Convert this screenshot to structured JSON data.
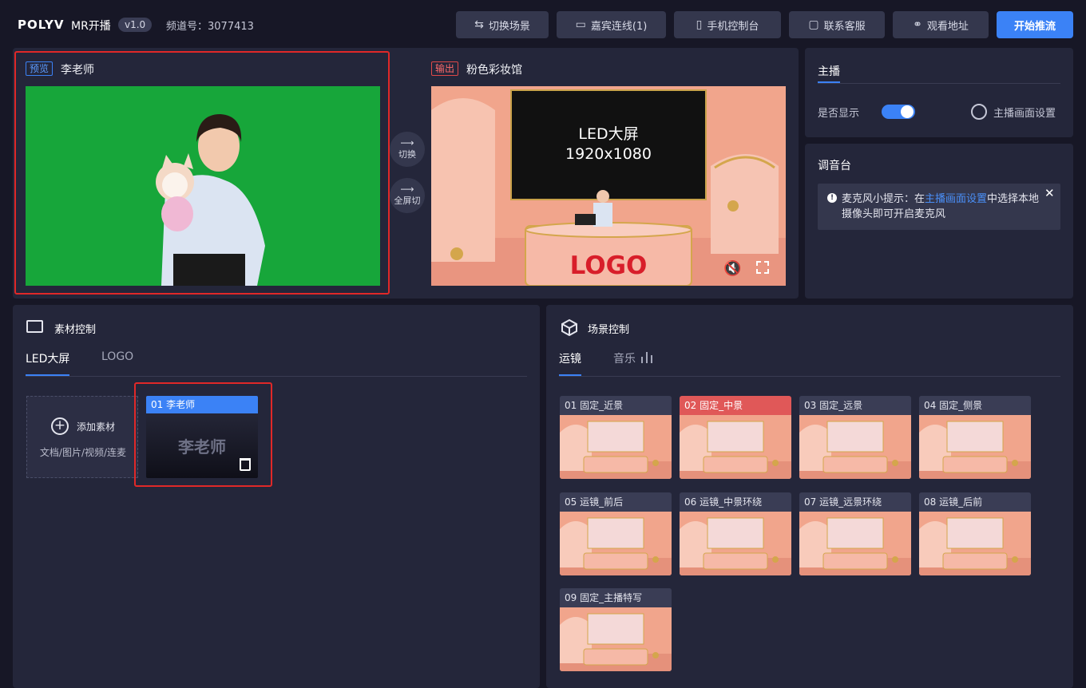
{
  "header": {
    "logo": "POLYV",
    "logo_sub": "MR开播",
    "version": "v1.0",
    "channel": "频道号：3077413",
    "buttons": [
      {
        "icon": "switch-scene-icon",
        "label": "切换场景"
      },
      {
        "icon": "video-camera-icon",
        "label": "嘉宾连线(1)"
      },
      {
        "icon": "tablet-icon",
        "label": "手机控制台"
      },
      {
        "icon": "chat-icon",
        "label": "联系客服"
      },
      {
        "icon": "link-icon",
        "label": "观看地址"
      }
    ],
    "start_label": "开始推流"
  },
  "preview": {
    "tag": "预览",
    "title": "李老师"
  },
  "output": {
    "tag": "输出",
    "title": "粉色彩妆馆",
    "led_line1": "LED大屏",
    "led_line2": "1920x1080",
    "logo_text": "LOGO"
  },
  "side_buttons": {
    "switch": "切换",
    "fullscreen_cut": "全屏切"
  },
  "host": {
    "title": "主播",
    "show_label": "是否显示",
    "show_enabled": true,
    "settings_label": "主播画面设置"
  },
  "mixer": {
    "title": "调音台",
    "tip_prefix": "麦克风小提示：在",
    "tip_link": "主播画面设置",
    "tip_suffix": "中选择本地摄像头即可开启麦克风"
  },
  "material": {
    "title": "素材控制",
    "tabs": [
      "LED大屏",
      "LOGO"
    ],
    "add_label": "添加素材",
    "add_hint": "文档/图片/视频/连麦",
    "item": {
      "index": "01",
      "name": "李老师",
      "thumb_text": "李老师"
    }
  },
  "scene": {
    "title": "场景控制",
    "tabs": [
      "运镜",
      "音乐"
    ],
    "cards": [
      {
        "label": "01 固定_近景"
      },
      {
        "label": "02 固定_中景"
      },
      {
        "label": "03 固定_远景"
      },
      {
        "label": "04 固定_侧景"
      },
      {
        "label": "05 运镜_前后"
      },
      {
        "label": "06 运镜_中景环绕"
      },
      {
        "label": "07 运镜_远景环绕"
      },
      {
        "label": "08 运镜_后前"
      },
      {
        "label": "09 固定_主播特写"
      }
    ],
    "active_index": 1
  },
  "colors": {
    "accent": "#3b82f6",
    "highlight": "#e02828",
    "active_card": "#e05858"
  }
}
